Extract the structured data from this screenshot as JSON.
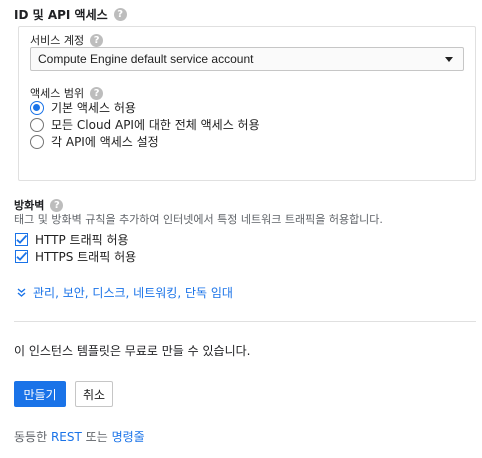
{
  "access": {
    "title": "ID 및 API 액세스",
    "service_account_label": "서비스 계정",
    "service_account_value": "Compute Engine default service account",
    "scope_label": "액세스 범위",
    "scopes": [
      {
        "label": "기본 액세스 허용",
        "selected": true
      },
      {
        "label": "모든 Cloud API에 대한 전체 액세스 허용",
        "selected": false
      },
      {
        "label": "각 API에 액세스 설정",
        "selected": false
      }
    ]
  },
  "firewall": {
    "title": "방화벽",
    "description": "태그 및 방화벽 규칙을 추가하여 인터넷에서 특정 네트워크 트래픽을 허용합니다.",
    "options": [
      {
        "label": "HTTP 트래픽 허용",
        "checked": true
      },
      {
        "label": "HTTPS 트래픽 허용",
        "checked": true
      }
    ]
  },
  "more_link": "관리, 보안, 디스크, 네트워킹, 단독 임대",
  "note": "이 인스턴스 템플릿은 무료로 만들 수 있습니다.",
  "buttons": {
    "create": "만들기",
    "cancel": "취소"
  },
  "footer": {
    "prefix": "동등한",
    "rest": "REST",
    "middle": "또는",
    "cli": "명령줄"
  },
  "help_glyph": "?",
  "colors": {
    "accent": "#1a73e8",
    "help_icon": "#bdbdbd",
    "border": "#e0e0e0"
  }
}
